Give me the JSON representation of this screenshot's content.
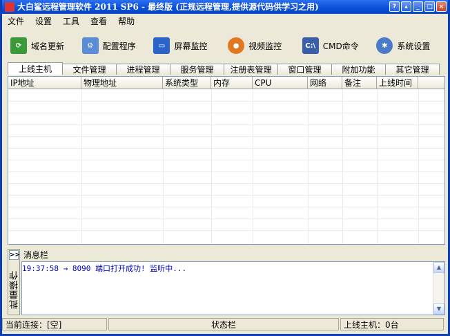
{
  "window": {
    "title": "大白鲨远程管理软件 2011 SP6 - 最终版 (正规远程管理,提供源代码供学习之用)",
    "buttons": [
      "help-icon",
      "restore-icon",
      "minimize-icon",
      "maximize-icon",
      "close-icon"
    ]
  },
  "menubar": {
    "items": [
      "文件",
      "设置",
      "工具",
      "查看",
      "帮助"
    ]
  },
  "toolbar": {
    "items": [
      {
        "label": "域名更新",
        "icon": "refresh-icon",
        "color": "#3a9a3a"
      },
      {
        "label": "配置程序",
        "icon": "config-icon",
        "color": "#5b8dd6"
      },
      {
        "label": "屏幕监控",
        "icon": "monitor-icon",
        "color": "#2a64c8"
      },
      {
        "label": "视频监控",
        "icon": "webcam-icon",
        "color": "#e07820"
      },
      {
        "label": "CMD命令",
        "icon": "cmd-icon",
        "color": "#3a5fa8"
      },
      {
        "label": "系统设置",
        "icon": "gear-icon",
        "color": "#4a7ac8"
      }
    ]
  },
  "tabs": [
    "上线主机",
    "文件管理",
    "进程管理",
    "服务管理",
    "注册表管理",
    "窗口管理",
    "附加功能",
    "其它管理"
  ],
  "table": {
    "columns": [
      "IP地址",
      "物理地址",
      "系统类型",
      "内存",
      "CPU",
      "网络",
      "备注",
      "上线时间"
    ],
    "rows": []
  },
  "sidebar": {
    "toggle": ">>",
    "label": "批量操作"
  },
  "messages": {
    "title": "消息栏",
    "lines": [
      "19:37:58 → 8090 端口打开成功! 监听中..."
    ]
  },
  "status": {
    "connection": "当前连接：[空]",
    "center": "状态栏",
    "online_hosts": "上线主机：0台"
  }
}
